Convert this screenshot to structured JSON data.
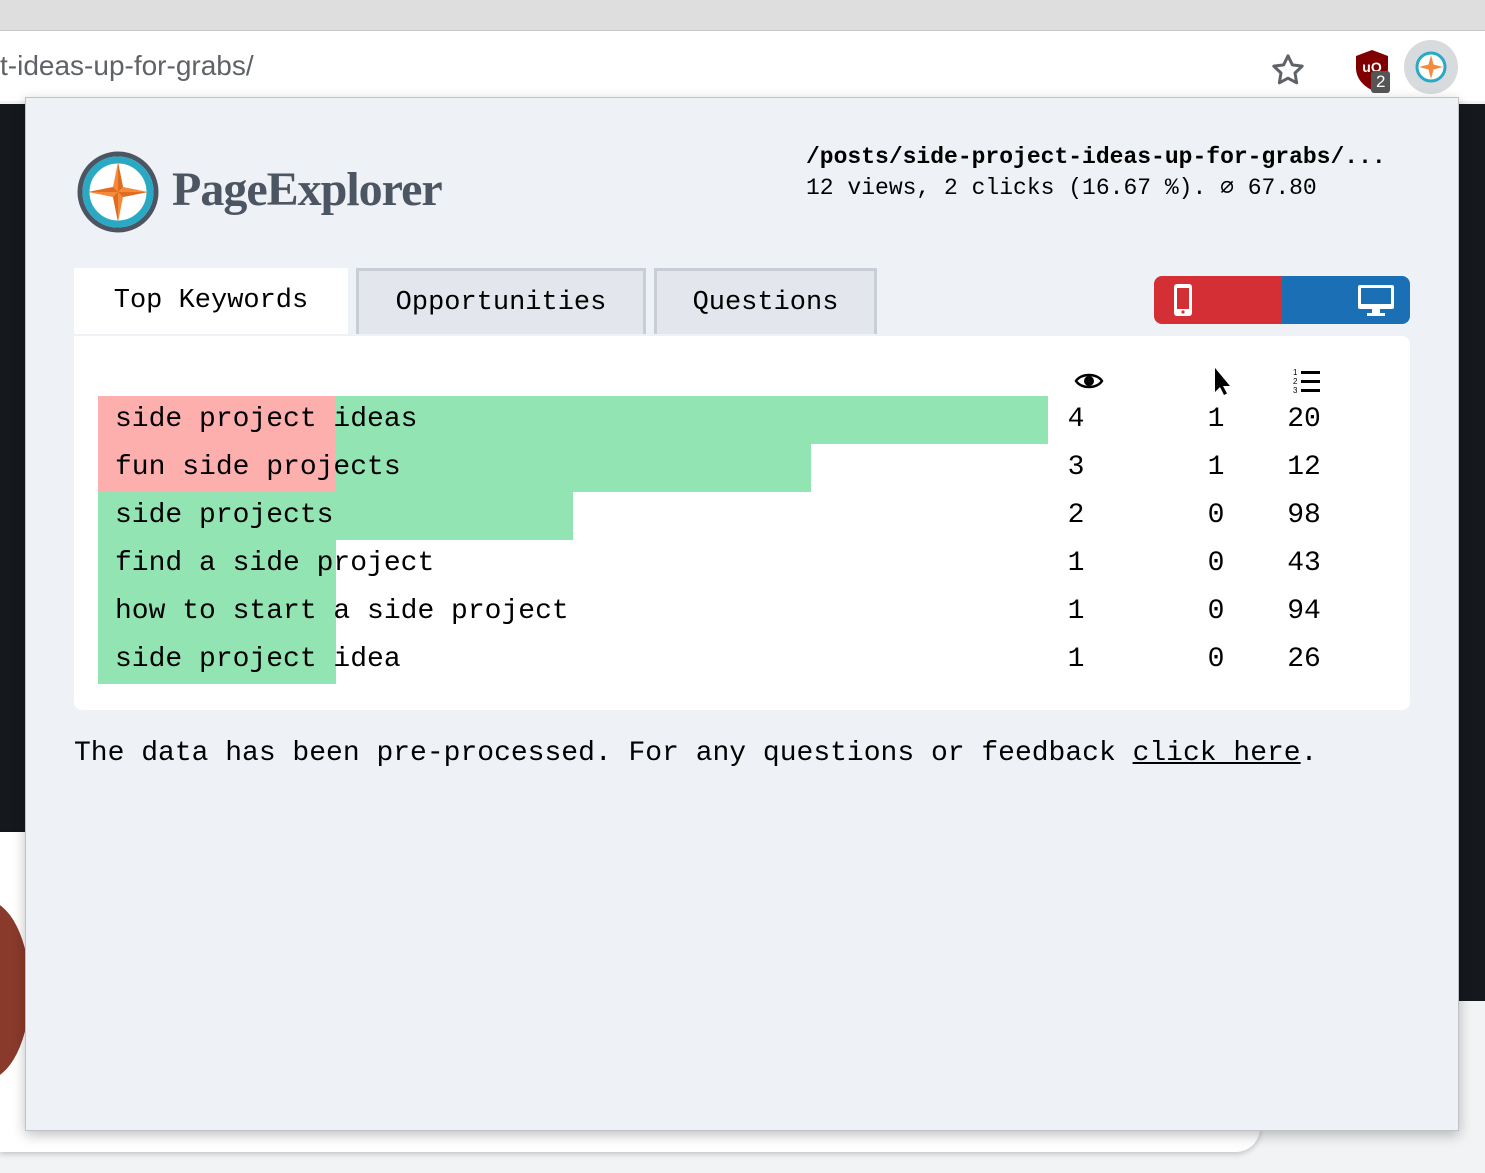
{
  "browser": {
    "url": "t-ideas-up-for-grabs/",
    "ublock_badge": "2"
  },
  "popup": {
    "brand": "PageExplorer",
    "page_path": "/posts/side-project-ideas-up-for-grabs/...",
    "page_stats": "12 views, 2 clicks (16.67 %). ∅ 67.80",
    "tabs": [
      {
        "label": "Top Keywords",
        "active": true
      },
      {
        "label": "Opportunities",
        "active": false
      },
      {
        "label": "Questions",
        "active": false
      }
    ],
    "device_toggle": {
      "mobile_color": "#d32f34",
      "desktop_color": "#1a6fb5"
    },
    "columns": {
      "views": "eye-icon",
      "clicks": "cursor-icon",
      "position": "ordered-list-icon"
    },
    "keywords": [
      {
        "keyword": "side project ideas",
        "views": "4",
        "clicks": "1",
        "position": "20",
        "views_share": 1.0,
        "clicks_share": 0.25
      },
      {
        "keyword": "fun side projects",
        "views": "3",
        "clicks": "1",
        "position": "12",
        "views_share": 0.75,
        "clicks_share": 0.25
      },
      {
        "keyword": "side projects",
        "views": "2",
        "clicks": "0",
        "position": "98",
        "views_share": 0.5,
        "clicks_share": 0
      },
      {
        "keyword": "find a side project",
        "views": "1",
        "clicks": "0",
        "position": "43",
        "views_share": 0.25,
        "clicks_share": 0
      },
      {
        "keyword": "how to start a side project",
        "views": "1",
        "clicks": "0",
        "position": "94",
        "views_share": 0.25,
        "clicks_share": 0
      },
      {
        "keyword": "side project idea",
        "views": "1",
        "clicks": "0",
        "position": "26",
        "views_share": 0.25,
        "clicks_share": 0
      }
    ],
    "colors": {
      "views_bar": "#93e4b3",
      "clicks_bar": "#fdafae"
    },
    "footer": {
      "text": "The data has been pre-processed. For any questions or feedback ",
      "link": "click here",
      "end": "."
    }
  }
}
